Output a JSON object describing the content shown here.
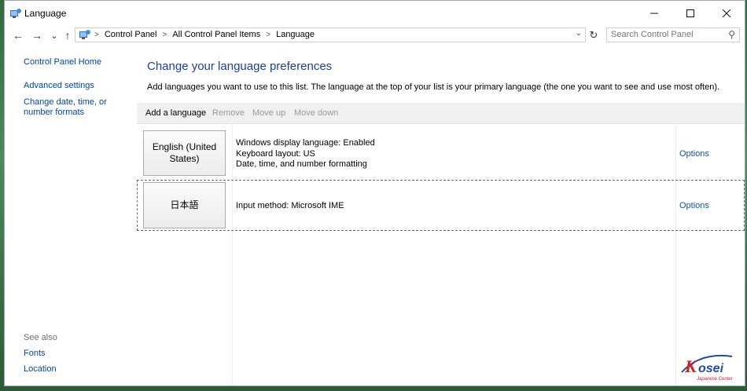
{
  "window": {
    "title": "Language",
    "icon": "control-panel-icon",
    "controls": [
      "minimize-icon",
      "maximize-icon",
      "close-icon"
    ]
  },
  "nav": {
    "back": "←",
    "forward": "→",
    "recent": "⌄",
    "up": "↑",
    "breadcrumb": [
      "Control Panel",
      "All Control Panel Items",
      "Language"
    ],
    "refresh": "↻",
    "search_placeholder": "Search Control Panel"
  },
  "sidebar": {
    "home": "Control Panel Home",
    "links": [
      "Advanced settings",
      "Change date, time, or number formats"
    ],
    "see_also_label": "See also",
    "see_also": [
      "Fonts",
      "Location"
    ]
  },
  "main": {
    "heading": "Change your language preferences",
    "intro": "Add languages you want to use to this list. The language at the top of your list is your primary language (the one you want to see and use most often).",
    "toolbar": {
      "add": "Add a language",
      "remove": "Remove",
      "move_up": "Move up",
      "move_down": "Move down"
    },
    "languages": [
      {
        "name": "English (United States)",
        "details": [
          "Windows display language: Enabled",
          "Keyboard layout: US",
          "Date, time, and number formatting"
        ],
        "options": "Options"
      },
      {
        "name": "日本語",
        "details": [
          "Input method: Microsoft IME"
        ],
        "options": "Options",
        "selected": true
      }
    ]
  },
  "watermark": {
    "brand": "Kosei",
    "tagline": "Japanese Center",
    "colors": {
      "red": "#d11f26",
      "blue": "#1f4aa8"
    }
  },
  "colors": {
    "link": "#0046a6",
    "heading": "#1a3f9c",
    "disabled": "#9a9a9a"
  }
}
